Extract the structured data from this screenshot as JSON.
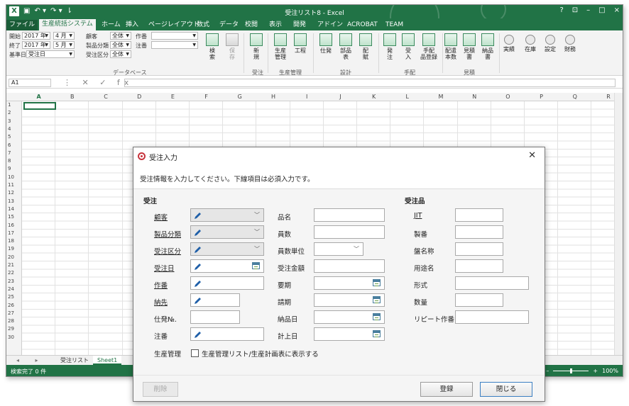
{
  "window": {
    "title": "受注リスト8 - Excel",
    "help": "?",
    "ribbon_opts": "⊡",
    "minimize": "–",
    "restore": "□",
    "close": "×"
  },
  "qat": {
    "save": "▣",
    "undo": "↶ ▾",
    "redo": "↷ ▾",
    "more": "⇂"
  },
  "tabs": [
    "ファイル",
    "生産統括システム",
    "ホーム",
    "挿入",
    "ページレイアウト",
    "数式",
    "データ",
    "校閲",
    "表示",
    "開発",
    "アドイン",
    "ACROBAT",
    "TEAM"
  ],
  "ribbon": {
    "start_label": "開始",
    "end_label": "終了",
    "base_label": "基準日",
    "start_year": "2017 年",
    "start_month": "4 月",
    "end_year": "2017 年",
    "end_month": "5 月",
    "base_value": "受注日",
    "customer_label": "顧客",
    "category_label": "製品分類",
    "order_type_label": "受注区分",
    "customer_value": "全体",
    "category_value": "全体",
    "order_type_value": "全体",
    "work_label": "作番",
    "note_label": "注番",
    "buttons": {
      "search": "検\n索",
      "save": "保\n存",
      "new": "新\n規",
      "prod_mgmt": "生産\n管理",
      "process": "工程",
      "spec": "仕発",
      "parts": "部品\n表",
      "layout": "配\n賦",
      "order_out": "発\n注",
      "receive": "受\n入",
      "arrange": "手配\n品登録",
      "dist": "配遣\n本数",
      "estimate": "見積\n書",
      "delivery": "納品\n書",
      "results": "実績",
      "stock": "在庫",
      "settings": "設定",
      "finance": "財務"
    },
    "groups": {
      "data_base": "データベース",
      "order": "受注",
      "production": "生産管理",
      "design": "設計",
      "arrangement": "手配",
      "quote": "見積"
    }
  },
  "formula_bar": {
    "name_box": "A1",
    "icons": "⋮ ✕ ✓ fx"
  },
  "grid": {
    "columns": [
      "A",
      "B",
      "C",
      "D",
      "E",
      "F",
      "G",
      "H",
      "I",
      "J",
      "K",
      "L",
      "M",
      "N",
      "O",
      "P",
      "Q",
      "R"
    ],
    "rows": [
      "1",
      "2",
      "3",
      "4",
      "5",
      "6",
      "7",
      "8",
      "9",
      "10",
      "11",
      "12",
      "13",
      "14",
      "15",
      "16",
      "17",
      "18",
      "19",
      "20",
      "21",
      "22",
      "23",
      "24",
      "25",
      "26",
      "27",
      "28",
      "29",
      "30"
    ]
  },
  "sheets": {
    "nav": "◂ ▸",
    "tabs": [
      "受注リスト",
      "Sheet1"
    ],
    "active": "Sheet1"
  },
  "status": {
    "text": "検索完了 0 件",
    "zoom": "100%",
    "minus": "–",
    "plus": "+"
  },
  "dialog": {
    "title": "受注入力",
    "close": "✕",
    "info": "受注情報を入力してください。下線項目は必須入力です。",
    "section_order": "受注",
    "section_product": "受注品",
    "col1": [
      "顧客",
      "製品分類",
      "受注区分",
      "受注日",
      "作番",
      "納先",
      "仕発№.",
      "注番",
      "生産管理"
    ],
    "col2": [
      "品名",
      "員数",
      "員数単位",
      "受注金額",
      "要期",
      "請期",
      "納品日",
      "計上日"
    ],
    "col3": [
      "JIT",
      "製番",
      "盤名称",
      "用途名",
      "形式",
      "数量",
      "リピート作番"
    ],
    "checkbox_label": "生産管理リスト/生産計画表に表示する",
    "buttons": {
      "delete": "削除",
      "register": "登録",
      "close": "閉じる"
    }
  },
  "colors": {
    "excel_green": "#217346",
    "accent_red": "#c8343d",
    "calendar_blue": "#4a7f9e"
  }
}
